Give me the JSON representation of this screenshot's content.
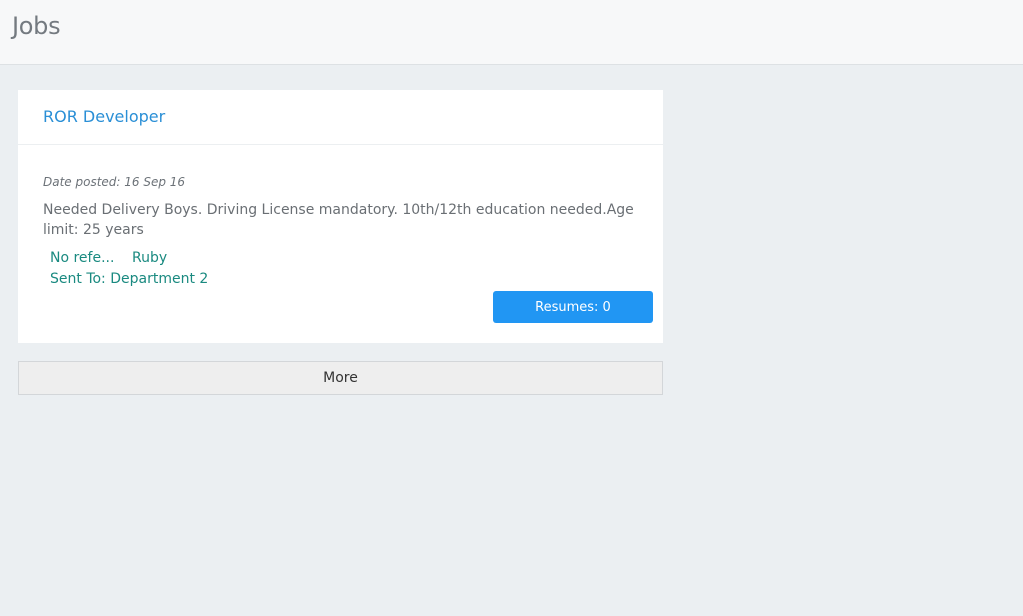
{
  "header": {
    "title": "Jobs"
  },
  "job": {
    "title": "ROR Developer",
    "date_posted": "Date posted: 16 Sep 16",
    "description": "Needed Delivery Boys. Driving License mandatory. 10th/12th education needed.Age limit: 25 years",
    "tags": {
      "referral": "No refe...",
      "skill": "Ruby",
      "sent_to": "Sent To: Department 2"
    },
    "resumes_label": "Resumes: 0"
  },
  "more_label": "More",
  "colors": {
    "accent": "#2196f3",
    "title_link": "#2a8fd6",
    "tag_text": "#1a8a80",
    "background": "#ebeff2"
  }
}
